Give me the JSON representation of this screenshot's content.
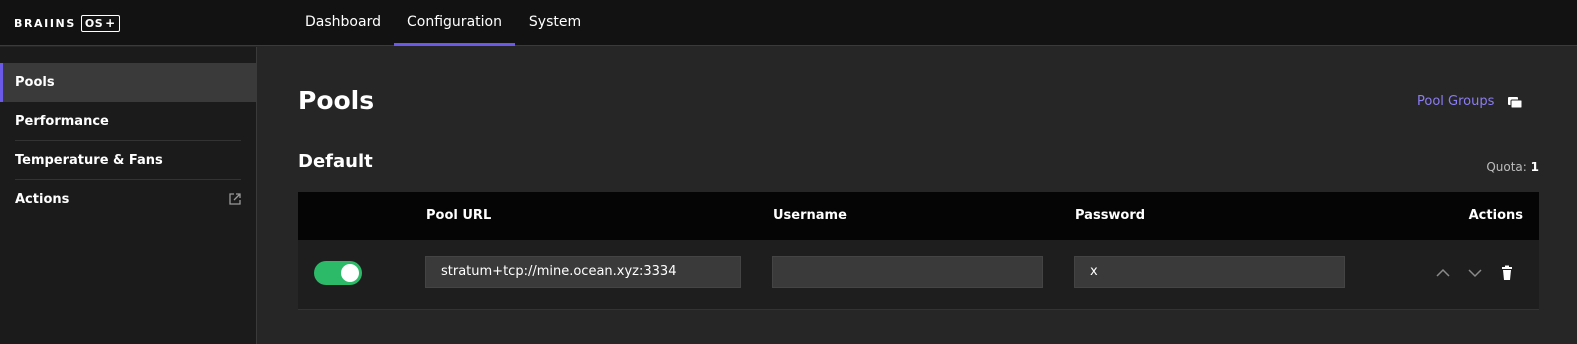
{
  "logo": {
    "word": "BRAIINS",
    "box": "OS",
    "plus": "+"
  },
  "nav": {
    "tabs": [
      {
        "label": "Dashboard",
        "active": false
      },
      {
        "label": "Configuration",
        "active": true
      },
      {
        "label": "System",
        "active": false
      }
    ]
  },
  "sidebar": {
    "items": [
      {
        "label": "Pools",
        "active": true
      },
      {
        "label": "Performance",
        "active": false
      },
      {
        "label": "Temperature & Fans",
        "active": false
      },
      {
        "label": "Actions",
        "active": false,
        "icon": "external-link-icon"
      }
    ]
  },
  "page": {
    "title": "Pools",
    "pool_groups_link": "Pool Groups",
    "pool_groups_icon": "folders-icon"
  },
  "group": {
    "name": "Default",
    "quota_label": "Quota:",
    "quota_value": "1"
  },
  "table": {
    "headers": {
      "url": "Pool URL",
      "username": "Username",
      "password": "Password",
      "actions": "Actions"
    },
    "rows": [
      {
        "enabled": true,
        "url": "stratum+tcp://mine.ocean.xyz:3334",
        "username": "",
        "password": "x"
      }
    ]
  },
  "colors": {
    "accent": "#6b5ae8",
    "link": "#8b7df5",
    "toggle_on": "#2dba68"
  }
}
